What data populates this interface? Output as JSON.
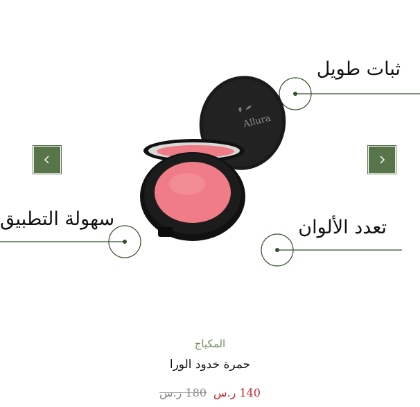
{
  "features": {
    "long_lasting": "ثبات طويل",
    "easy_application": "سهولة التطبيق",
    "multiple_colors": "تعدد الألوان"
  },
  "product": {
    "brand_on_lid": "Allura",
    "category": "المكياج",
    "title": "حمرة خدود الورا",
    "price_current": "140 ر.س",
    "price_original": "180 ر.س"
  },
  "carousel": {
    "prev_icon": "chevron-left-icon",
    "next_icon": "chevron-right-icon"
  },
  "colors": {
    "accent_green": "#58754a",
    "price_red": "#c0282d",
    "blush_pink": "#ef7c86"
  }
}
